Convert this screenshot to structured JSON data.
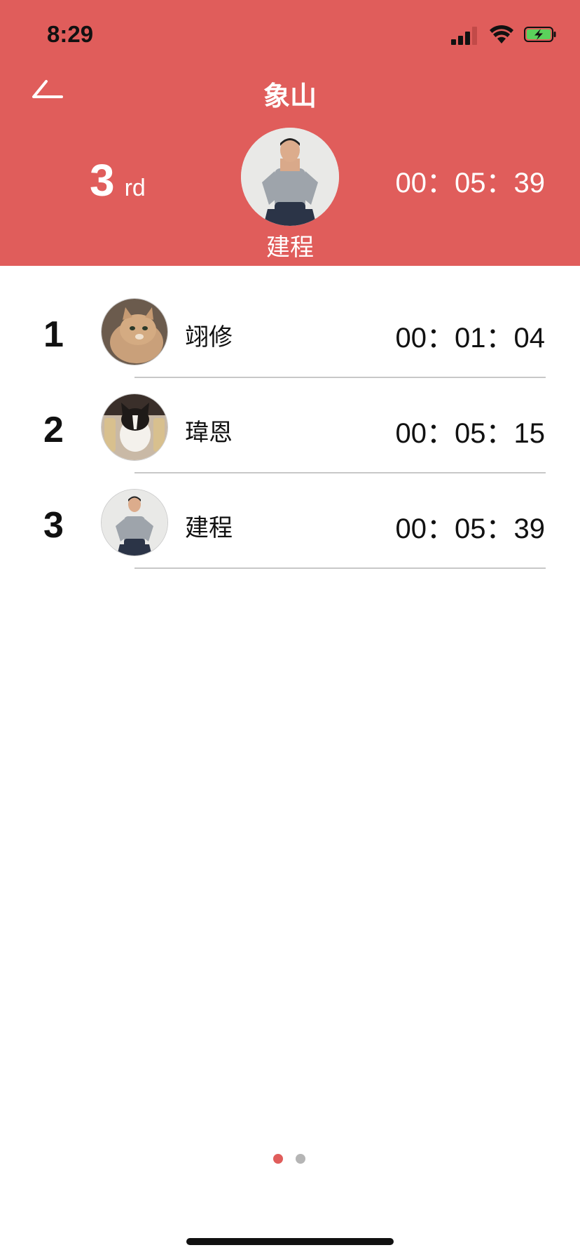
{
  "status_bar": {
    "time": "8:29"
  },
  "nav": {
    "title": "象山"
  },
  "current_user": {
    "rank": "3",
    "rank_suffix": "rd",
    "name": "建程",
    "time": "00：05：39"
  },
  "leaderboard": [
    {
      "rank": "1",
      "name": "翊修",
      "time": "00：01：04",
      "avatar": "cat-avatar"
    },
    {
      "rank": "2",
      "name": "瑋恩",
      "time": "00：05：15",
      "avatar": "kitten-avatar"
    },
    {
      "rank": "3",
      "name": "建程",
      "time": "00：05：39",
      "avatar": "man-avatar"
    }
  ],
  "pager": {
    "pages": 2,
    "current": 1
  },
  "colors": {
    "header_bg": "#e05d5b",
    "dot_active": "#e05d5b",
    "dot_inactive": "#b5b5b5",
    "divider": "#c8c8c8"
  }
}
